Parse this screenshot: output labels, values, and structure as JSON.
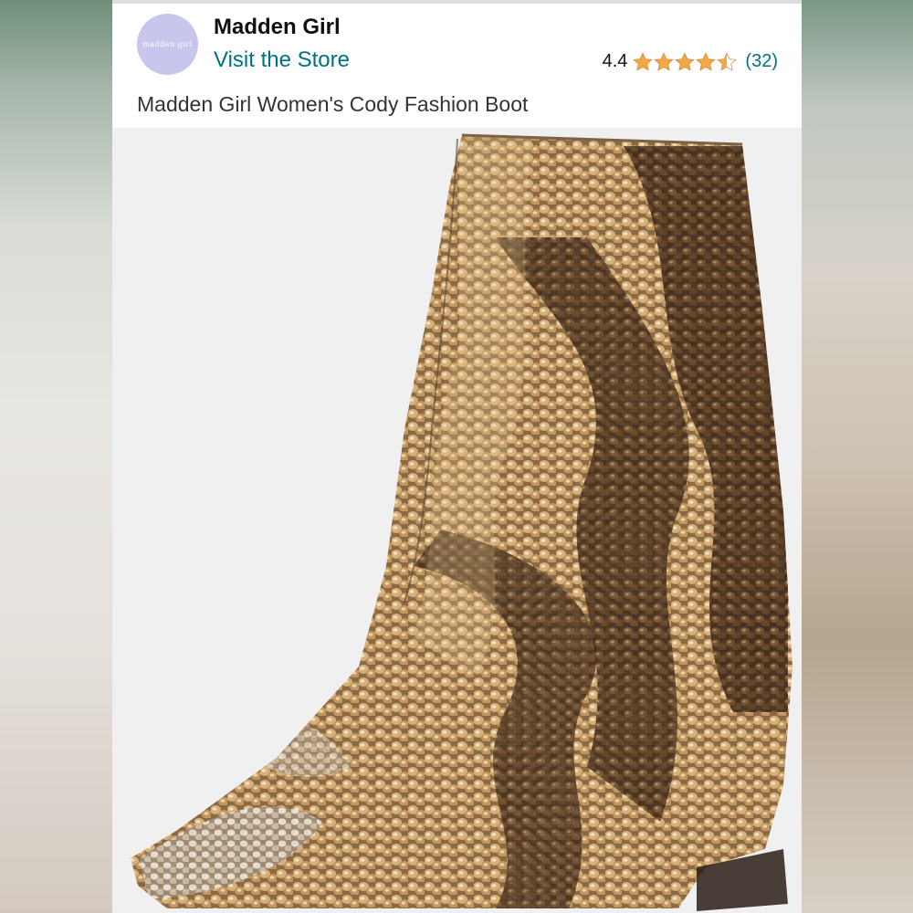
{
  "store": {
    "logo_text": "madden girl",
    "brand_name": "Madden Girl",
    "visit_label": "Visit the Store"
  },
  "rating": {
    "value": "4.4",
    "stars": 4.4,
    "count_label": "(32)",
    "star_color": "#f3a847"
  },
  "product": {
    "title": "Madden Girl Women's Cody Fashion Boot",
    "image_icon": "sequin-ankle-boot-image"
  },
  "colors": {
    "link": "#007185",
    "logo_bg": "#c8c6ec",
    "sequin_gold": "#c9a26a"
  }
}
